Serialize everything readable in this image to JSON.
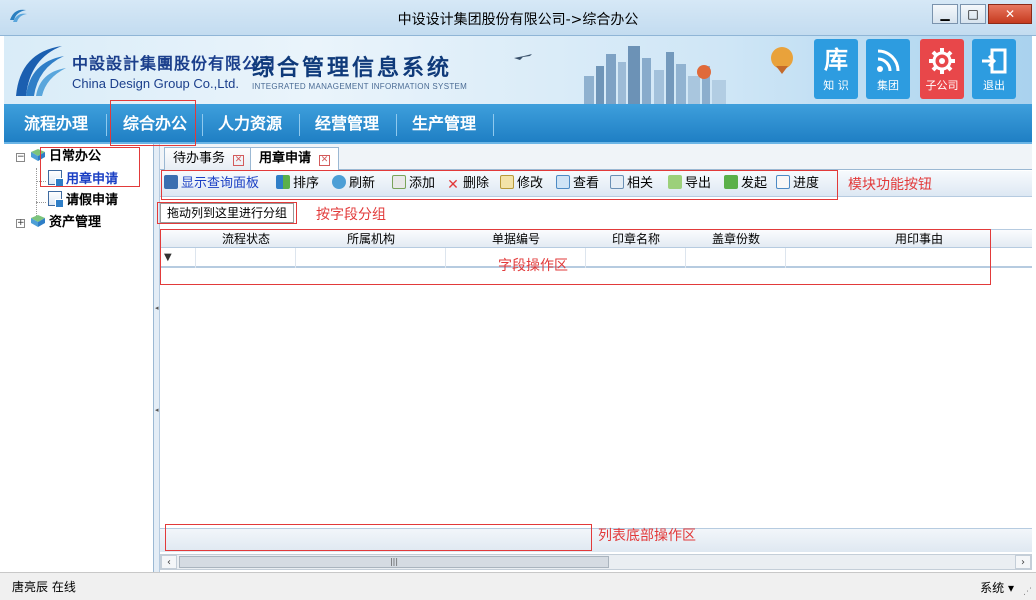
{
  "window": {
    "title": "中设设计集团股份有限公司->综合办公"
  },
  "header": {
    "logo_cn": "中設設計集團股份有限公司",
    "logo_en": "China Design Group Co.,Ltd.",
    "system_title": "综合管理信息系统",
    "system_subtitle": "INTEGRATED MANAGEMENT INFORMATION SYSTEM",
    "tiles": [
      {
        "icon": "库",
        "label": "知 识",
        "color": "#2d9ce0"
      },
      {
        "icon": "rss-icon",
        "label": "集团",
        "color": "#2d9ce0"
      },
      {
        "icon": "gear-icon",
        "label": "子公司",
        "color": "#e8474a"
      },
      {
        "icon": "exit-icon",
        "label": "退出",
        "color": "#2d9ce0"
      }
    ]
  },
  "menu": {
    "items": [
      "流程办理",
      "综合办公",
      "人力资源",
      "经营管理",
      "生产管理"
    ]
  },
  "tree": {
    "nodes": [
      {
        "label": "日常办公"
      },
      {
        "label": "用章申请"
      },
      {
        "label": "请假申请"
      },
      {
        "label": "资产管理"
      }
    ]
  },
  "tabs": [
    {
      "label": "待办事务"
    },
    {
      "label": "用章申请"
    }
  ],
  "toolbar": {
    "buttons": [
      "显示查询面板",
      "排序",
      "刷新",
      "添加",
      "删除",
      "修改",
      "查看",
      "相关",
      "导出",
      "发起",
      "进度"
    ]
  },
  "grid": {
    "group_hint": "拖动列到这里进行分组",
    "columns": [
      "流程状态",
      "所属机构",
      "单据编号",
      "印章名称",
      "盖章份数",
      "用印事由"
    ]
  },
  "annotations": {
    "toolbar": "模块功能按钮",
    "group": "按字段分组",
    "fields": "字段操作区",
    "footer": "列表底部操作区"
  },
  "status": {
    "user": "唐亮辰 在线",
    "system_menu": "系统"
  },
  "colors": {
    "menu_blue": "#1f7fc4",
    "annotation_red": "#e23a3a",
    "link_blue": "#1a3fc4"
  }
}
